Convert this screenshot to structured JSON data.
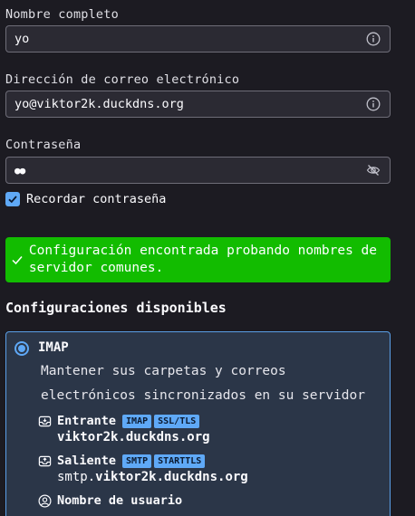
{
  "form": {
    "name_label": "Nombre completo",
    "name_value": "yo",
    "email_label": "Dirección de correo electrónico",
    "email_value": "yo@viktor2k.duckdns.org",
    "password_label": "Contraseña",
    "password_value": "●●",
    "remember_label": "Recordar contraseña",
    "remember_checked": true
  },
  "notice": {
    "text": "Configuración encontrada probando nombres de servidor comunes.",
    "color": "#12bc00"
  },
  "configs": {
    "title": "Configuraciones disponibles",
    "accent": "#5fa9f7",
    "option": {
      "protocol": "IMAP",
      "selected": true,
      "description": "Mantener sus carpetas y correos electrónicos sincronizados en su servidor",
      "incoming": {
        "label": "Entrante",
        "badges": [
          "IMAP",
          "SSL/TLS"
        ],
        "host": "viktor2k.duckdns.org"
      },
      "outgoing": {
        "label": "Saliente",
        "badges": [
          "SMTP",
          "STARTTLS"
        ],
        "host_prefix": "smtp.",
        "host_main": "viktor2k.duckdns.org"
      },
      "username": {
        "label": "Nombre de usuario"
      }
    }
  }
}
